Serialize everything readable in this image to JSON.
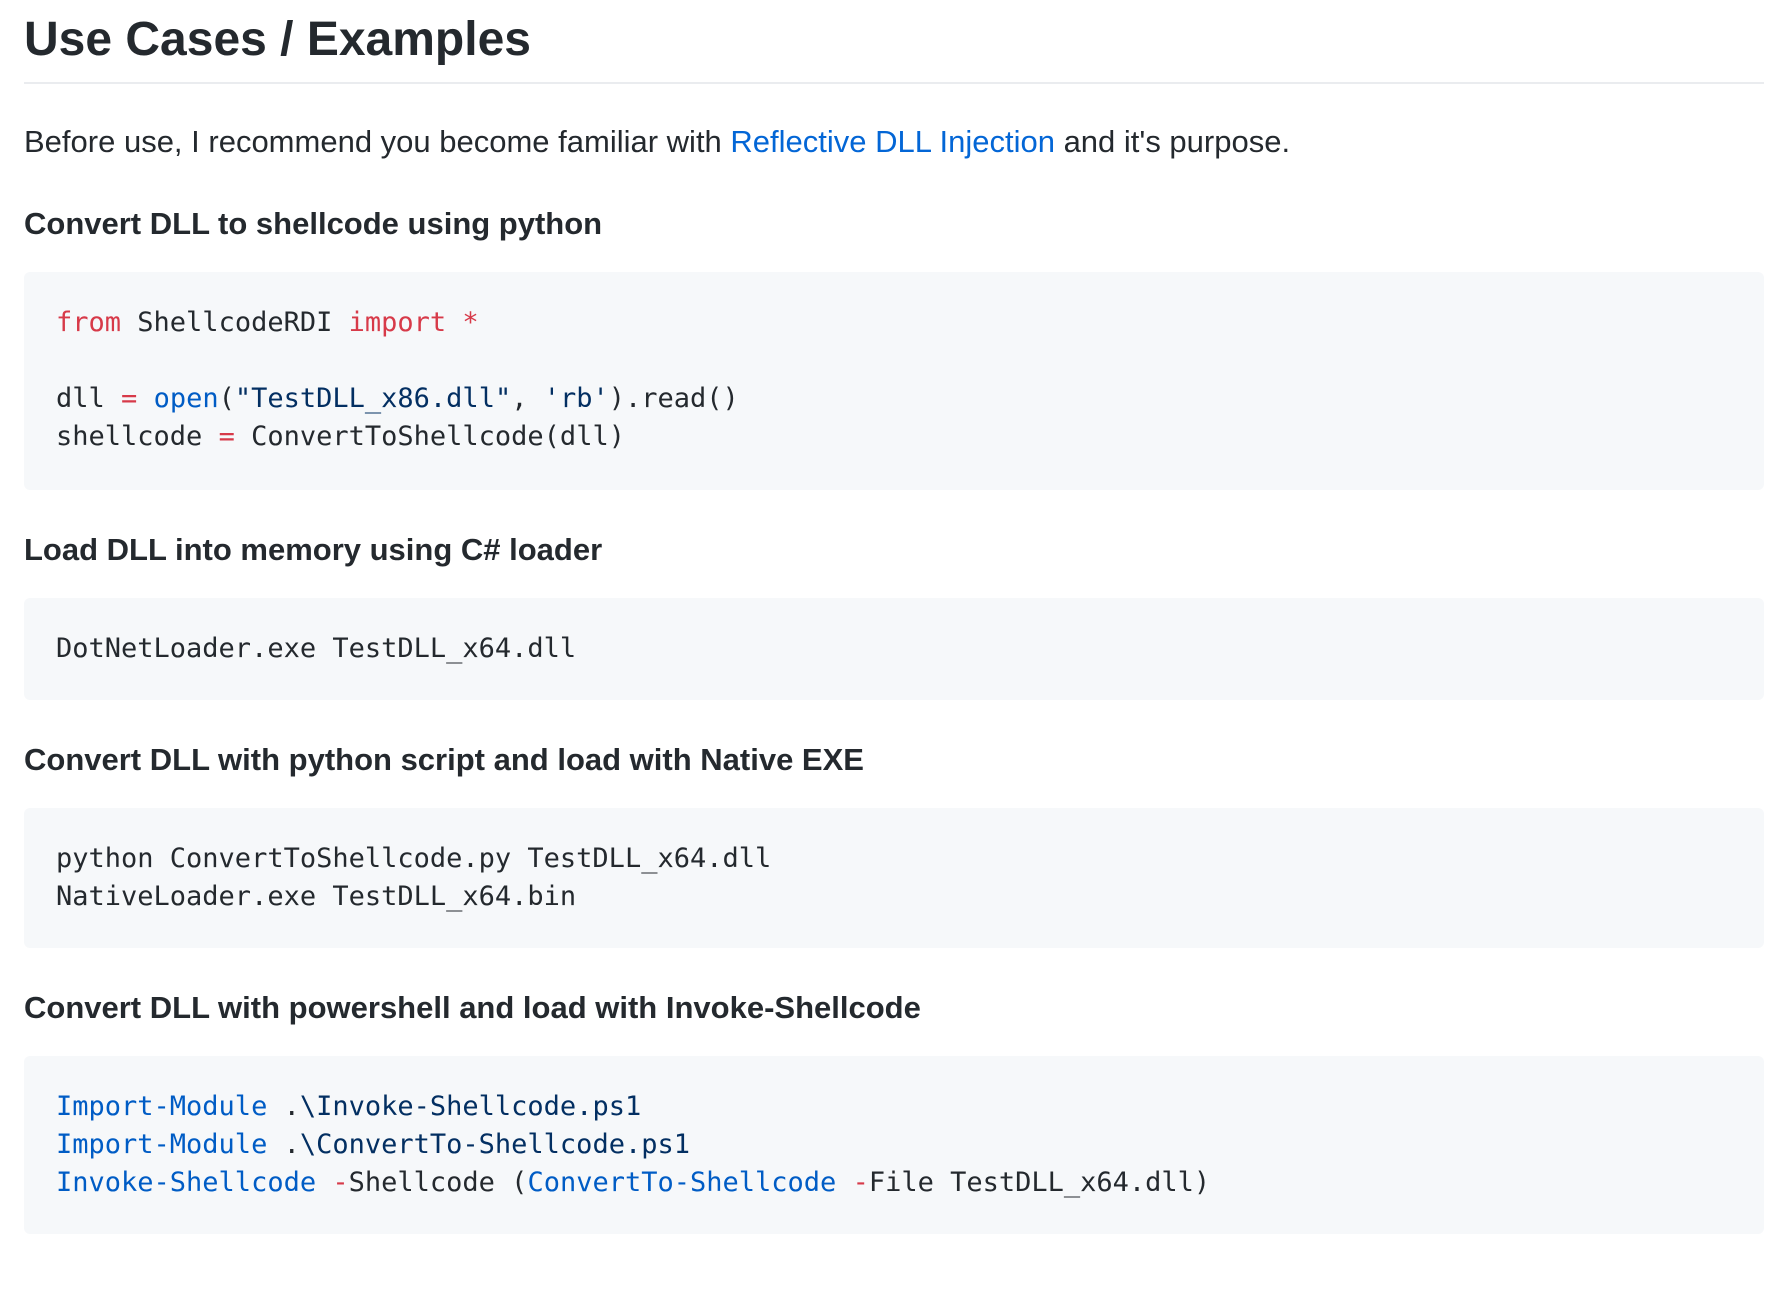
{
  "heading": "Use Cases / Examples",
  "intro": {
    "before": "Before use, I recommend you become familiar with ",
    "link": "Reflective DLL Injection",
    "after": " and it's purpose."
  },
  "sections": [
    {
      "title": "Convert DLL to shellcode using python",
      "code": {
        "l1_from": "from",
        "l1_mod": " ShellcodeRDI ",
        "l1_import": "import",
        "l1_star": " *",
        "l3_a": "dll ",
        "l3_eq": "=",
        "l3_sp": " ",
        "l3_open": "open",
        "l3_p1": "(",
        "l3_str1": "\"TestDLL_x86.dll\"",
        "l3_comma": ", ",
        "l3_str2": "'rb'",
        "l3_rest": ").read()",
        "l4_a": "shellcode ",
        "l4_eq": "=",
        "l4_rest": " ConvertToShellcode(dll)"
      }
    },
    {
      "title": "Load DLL into memory using C# loader",
      "code": {
        "l1": "DotNetLoader.exe TestDLL_x64.dll"
      }
    },
    {
      "title": "Convert DLL with python script and load with Native EXE",
      "code": {
        "l1": "python ConvertToShellcode.py TestDLL_x64.dll",
        "l2": "NativeLoader.exe TestDLL_x64.bin"
      }
    },
    {
      "title": "Convert DLL with powershell and load with Invoke-Shellcode",
      "code": {
        "l1_cmd": "Import-Module",
        "l1_dot": " .",
        "l1_path": "\\Invoke-Shellcode.ps1",
        "l2_cmd": "Import-Module",
        "l2_dot": " .",
        "l2_path": "\\ConvertTo-Shellcode.ps1",
        "l3_cmd": "Invoke-Shellcode",
        "l3_sp": " ",
        "l3_dash1": "-",
        "l3_param1": "Shellcode (",
        "l3_cmd2": "ConvertTo-Shellcode",
        "l3_sp2": " ",
        "l3_dash2": "-",
        "l3_param2": "File TestDLL_x64.dll)"
      }
    }
  ]
}
